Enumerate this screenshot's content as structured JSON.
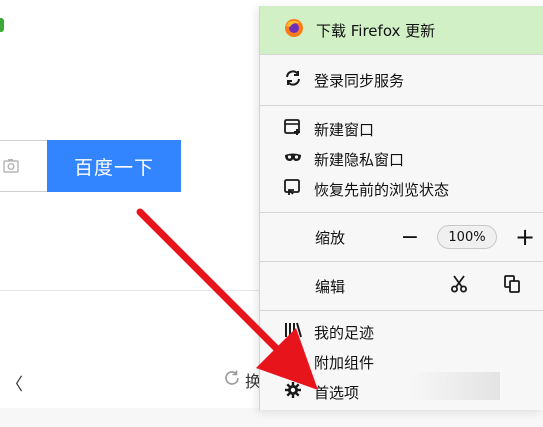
{
  "page": {
    "search_button_label": "百度一下",
    "edge_text": "〈",
    "refresh_text": "换"
  },
  "menu": {
    "update_label": "下载 Firefox 更新",
    "sync_label": "登录同步服务",
    "new_window_label": "新建窗口",
    "private_window_label": "新建隐私窗口",
    "restore_label": "恢复先前的浏览状态",
    "zoom_label": "缩放",
    "zoom_minus": "−",
    "zoom_value": "100%",
    "zoom_plus": "+",
    "edit_label": "编辑",
    "library_label": "我的足迹",
    "addons_label": "附加组件",
    "preferences_label": "首选项"
  },
  "colors": {
    "search_button": "#3385ff",
    "update_bg": "#d2f0c6",
    "arrow": "#e8141b"
  },
  "icons": [
    "camera-icon",
    "firefox-logo-icon",
    "sync-icon",
    "new-window-icon",
    "mask-icon",
    "restore-icon",
    "cut-icon",
    "copy-icon",
    "library-icon",
    "puzzle-icon",
    "gear-icon",
    "refresh-icon"
  ]
}
